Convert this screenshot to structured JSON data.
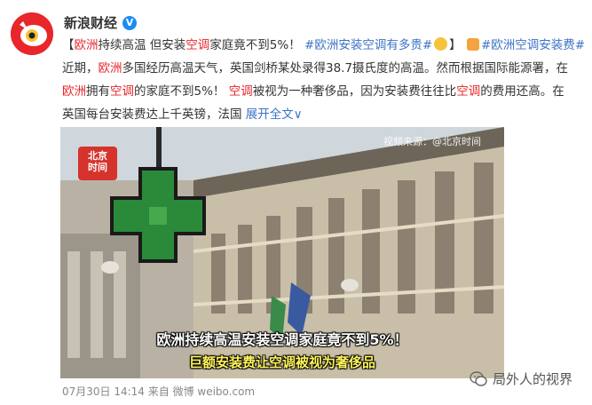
{
  "account": {
    "name": "新浪财经",
    "verified_mark": "V"
  },
  "post": {
    "bracket_open": "【",
    "kw_europe": "欧洲",
    "title_rest_a": "持续高温 但安装",
    "kw_ac": "空调",
    "title_rest_b": "家庭竟不到5%！",
    "tag1": "#欧洲安装空调有多贵#",
    "bracket_close": "】",
    "tag2": "#欧洲空调安装费#",
    "line2_a": "近期，",
    "line2_b": "欧洲",
    "line2_c": "多国经历高温天气，英国剑桥某处录得38.7摄氏度的高温。然而根据国际能源署，在",
    "line3_a": "欧洲",
    "line3_b": "拥有",
    "line3_c": "空调",
    "line3_d": "的家庭不到5%！ ",
    "line3_e": "空调",
    "line3_f": "被视为一种奢侈品，因为安装费往往比",
    "line3_g": "空调",
    "line3_h": "的费用还高。在",
    "line4_a": "英国每台安装费达上千英镑，法国 ",
    "expand": "展开全文",
    "expand_arrow": "∨"
  },
  "video": {
    "logo_line1": "北京",
    "logo_line2": "时间",
    "source": "视频来源：@北京时间",
    "caption_main": "欧洲持续高温安装空调家庭竟不到5%！",
    "caption_sub": "巨额安装费让空调被视为奢侈品"
  },
  "footer": {
    "meta": "07月30日 14:14 来自 微博 weibo.com"
  },
  "watermark": {
    "text": "局外人的视界"
  },
  "colors": {
    "keyword_red": "#e8262b",
    "hashtag_blue": "#3d73c4",
    "verified_blue": "#1a8df0",
    "caption_yellow": "#fff45a"
  },
  "icons": {
    "avatar": "sina-eye-logo",
    "verified": "verified-badge-icon",
    "emoji": "thinking-face-emoji",
    "hashtag": "hashtag-icon",
    "watermark": "wechat-icon"
  }
}
